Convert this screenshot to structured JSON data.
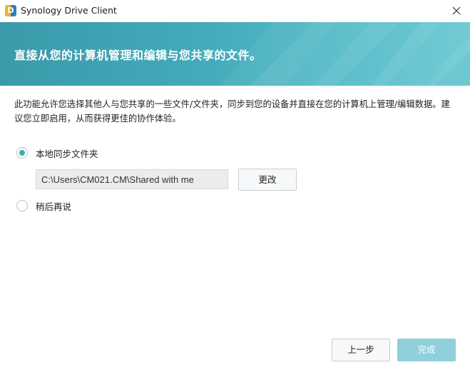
{
  "window": {
    "title": "Synology Drive Client",
    "icon_letter": "D"
  },
  "banner": {
    "title": "直接从您的计算机管理和编辑与您共享的文件。",
    "color_start": "#3a9aaa",
    "color_end": "#66c6d1"
  },
  "description": "此功能允许您选择其他人与您共享的一些文件/文件夹，同步到您的设备并直接在您的计算机上管理/编辑数据。建议您立即启用，从而获得更佳的协作体验。",
  "options": {
    "local_sync": {
      "label": "本地同步文件夹",
      "selected": true
    },
    "later": {
      "label": "稍后再说",
      "selected": false
    }
  },
  "path_field": {
    "value": "C:\\Users\\CM021.CM\\Shared with me"
  },
  "buttons": {
    "change": "更改",
    "previous": "上一步",
    "finish": "完成"
  },
  "colors": {
    "accent": "#3fa9b8",
    "finish_button": "#8fd0da"
  }
}
